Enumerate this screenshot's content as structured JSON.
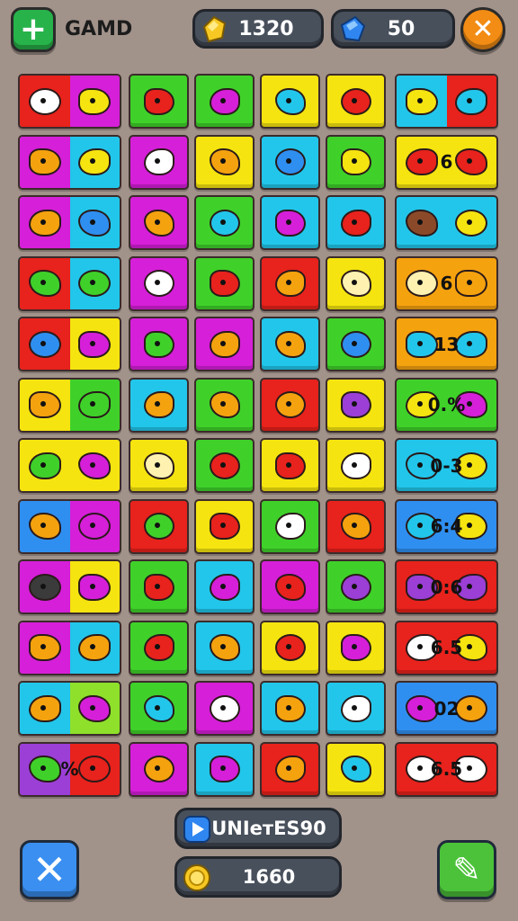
{
  "header": {
    "title": "GAMD",
    "coins": "1320",
    "gems": "50",
    "add_symbol": "+",
    "close_symbol": "✕"
  },
  "colors": {
    "red": "#e8221c",
    "magenta": "#d61fd8",
    "green": "#3fd12a",
    "yellow": "#f5e40f",
    "cyan": "#22c6ea",
    "blue": "#2f8ff0",
    "orange": "#f5a20f",
    "lime": "#8ee02a",
    "purple": "#9b3fd6"
  },
  "board": {
    "rows": [
      {
        "cells": [
          {
            "c": [
              "red",
              "magenta"
            ],
            "icons": [
              "#ffffff",
              "#f5e40f"
            ]
          },
          {
            "c": [
              "green"
            ],
            "icons": [
              "#e8221c"
            ]
          },
          {
            "c": [
              "green"
            ],
            "icons": [
              "#d61fd8"
            ]
          },
          {
            "c": [
              "yellow"
            ],
            "icons": [
              "#22c6ea"
            ]
          },
          {
            "c": [
              "yellow"
            ],
            "icons": [
              "#e8221c"
            ]
          },
          {
            "c": [
              "cyan",
              "red"
            ],
            "icons": [
              "#f5e40f",
              "#22c6ea"
            ]
          }
        ]
      },
      {
        "cells": [
          {
            "c": [
              "magenta",
              "cyan"
            ],
            "icons": [
              "#f5a20f",
              "#f5e40f"
            ]
          },
          {
            "c": [
              "magenta"
            ],
            "icons": [
              "#ffffff"
            ]
          },
          {
            "c": [
              "yellow"
            ],
            "icons": [
              "#f5a20f"
            ]
          },
          {
            "c": [
              "cyan"
            ],
            "icons": [
              "#2f8ff0"
            ]
          },
          {
            "c": [
              "green"
            ],
            "icons": [
              "#f5e40f"
            ]
          },
          {
            "c": [
              "yellow"
            ],
            "icons": [
              "#e8221c",
              "#e8221c"
            ],
            "label": "6"
          }
        ]
      },
      {
        "cells": [
          {
            "c": [
              "magenta",
              "cyan"
            ],
            "icons": [
              "#f5a20f",
              "#2f8ff0"
            ]
          },
          {
            "c": [
              "magenta"
            ],
            "icons": [
              "#f5a20f"
            ]
          },
          {
            "c": [
              "green"
            ],
            "icons": [
              "#22c6ea"
            ]
          },
          {
            "c": [
              "cyan"
            ],
            "icons": [
              "#d61fd8"
            ]
          },
          {
            "c": [
              "cyan"
            ],
            "icons": [
              "#e8221c"
            ]
          },
          {
            "c": [
              "cyan"
            ],
            "icons": [
              "#8a4a2a",
              "#f5e40f"
            ]
          }
        ]
      },
      {
        "cells": [
          {
            "c": [
              "red",
              "cyan"
            ],
            "icons": [
              "#3fd12a",
              "#3fd12a"
            ]
          },
          {
            "c": [
              "magenta"
            ],
            "icons": [
              "#ffffff"
            ]
          },
          {
            "c": [
              "green"
            ],
            "icons": [
              "#e8221c"
            ]
          },
          {
            "c": [
              "red"
            ],
            "icons": [
              "#f5a20f"
            ]
          },
          {
            "c": [
              "yellow"
            ],
            "icons": [
              "#fff2b0"
            ]
          },
          {
            "c": [
              "orange"
            ],
            "icons": [
              "#fff2b0",
              "#f5a20f"
            ],
            "label": "6"
          }
        ]
      },
      {
        "cells": [
          {
            "c": [
              "red",
              "yellow"
            ],
            "icons": [
              "#2f8ff0",
              "#d61fd8"
            ]
          },
          {
            "c": [
              "magenta"
            ],
            "icons": [
              "#3fd12a"
            ]
          },
          {
            "c": [
              "magenta"
            ],
            "icons": [
              "#f5a20f"
            ]
          },
          {
            "c": [
              "cyan"
            ],
            "icons": [
              "#f5a20f"
            ]
          },
          {
            "c": [
              "green"
            ],
            "icons": [
              "#2f8ff0"
            ]
          },
          {
            "c": [
              "orange"
            ],
            "icons": [
              "#22c6ea",
              "#22c6ea"
            ],
            "label": "13"
          }
        ]
      },
      {
        "cells": [
          {
            "c": [
              "yellow",
              "green"
            ],
            "icons": [
              "#f5a20f",
              "#3fd12a"
            ]
          },
          {
            "c": [
              "cyan"
            ],
            "icons": [
              "#f5a20f"
            ]
          },
          {
            "c": [
              "green"
            ],
            "icons": [
              "#f5a20f"
            ]
          },
          {
            "c": [
              "red"
            ],
            "icons": [
              "#f5a20f"
            ]
          },
          {
            "c": [
              "yellow"
            ],
            "icons": [
              "#9b3fd6"
            ]
          },
          {
            "c": [
              "green"
            ],
            "icons": [
              "#f5e40f",
              "#d61fd8"
            ],
            "label": "0.%"
          }
        ]
      },
      {
        "cells": [
          {
            "c": [
              "yellow",
              "yellow"
            ],
            "icons": [
              "#3fd12a",
              "#d61fd8"
            ]
          },
          {
            "c": [
              "yellow"
            ],
            "icons": [
              "#fff2b0"
            ]
          },
          {
            "c": [
              "green"
            ],
            "icons": [
              "#e8221c"
            ]
          },
          {
            "c": [
              "yellow"
            ],
            "icons": [
              "#e8221c"
            ]
          },
          {
            "c": [
              "yellow"
            ],
            "icons": [
              "#ffffff"
            ]
          },
          {
            "c": [
              "cyan"
            ],
            "icons": [
              "#22c6ea",
              "#f5e40f"
            ],
            "label": "0-3"
          }
        ]
      },
      {
        "cells": [
          {
            "c": [
              "blue",
              "magenta"
            ],
            "icons": [
              "#f5a20f",
              "#d61fd8"
            ]
          },
          {
            "c": [
              "red"
            ],
            "icons": [
              "#3fd12a"
            ]
          },
          {
            "c": [
              "yellow"
            ],
            "icons": [
              "#e8221c"
            ]
          },
          {
            "c": [
              "green"
            ],
            "icons": [
              "#ffffff"
            ]
          },
          {
            "c": [
              "red"
            ],
            "icons": [
              "#f5a20f"
            ]
          },
          {
            "c": [
              "blue"
            ],
            "icons": [
              "#22c6ea",
              "#f5e40f"
            ],
            "label": "6:4"
          }
        ]
      },
      {
        "cells": [
          {
            "c": [
              "magenta",
              "yellow"
            ],
            "icons": [
              "#3b3b3b",
              "#d61fd8"
            ]
          },
          {
            "c": [
              "green"
            ],
            "icons": [
              "#e8221c"
            ]
          },
          {
            "c": [
              "cyan"
            ],
            "icons": [
              "#d61fd8"
            ]
          },
          {
            "c": [
              "magenta"
            ],
            "icons": [
              "#e8221c"
            ]
          },
          {
            "c": [
              "green"
            ],
            "icons": [
              "#9b3fd6"
            ]
          },
          {
            "c": [
              "red"
            ],
            "icons": [
              "#9b3fd6",
              "#9b3fd6"
            ],
            "label": "0:6"
          }
        ]
      },
      {
        "cells": [
          {
            "c": [
              "magenta",
              "cyan"
            ],
            "icons": [
              "#f5a20f",
              "#f5a20f"
            ]
          },
          {
            "c": [
              "green"
            ],
            "icons": [
              "#e8221c"
            ]
          },
          {
            "c": [
              "cyan"
            ],
            "icons": [
              "#f5a20f"
            ]
          },
          {
            "c": [
              "yellow"
            ],
            "icons": [
              "#e8221c"
            ]
          },
          {
            "c": [
              "yellow"
            ],
            "icons": [
              "#d61fd8"
            ]
          },
          {
            "c": [
              "red"
            ],
            "icons": [
              "#ffffff",
              "#f5e40f"
            ],
            "label": "6.5"
          }
        ]
      },
      {
        "cells": [
          {
            "c": [
              "cyan",
              "lime"
            ],
            "icons": [
              "#f5a20f",
              "#d61fd8"
            ]
          },
          {
            "c": [
              "green"
            ],
            "icons": [
              "#22c6ea"
            ]
          },
          {
            "c": [
              "magenta"
            ],
            "icons": [
              "#ffffff"
            ]
          },
          {
            "c": [
              "cyan"
            ],
            "icons": [
              "#f5a20f"
            ]
          },
          {
            "c": [
              "cyan"
            ],
            "icons": [
              "#ffffff"
            ]
          },
          {
            "c": [
              "blue"
            ],
            "icons": [
              "#d61fd8",
              "#f5a20f"
            ],
            "label": "02"
          }
        ]
      },
      {
        "cells": [
          {
            "c": [
              "purple",
              "red"
            ],
            "icons": [
              "#3fd12a",
              "#e8221c"
            ],
            "label": "%"
          },
          {
            "c": [
              "magenta"
            ],
            "icons": [
              "#f5a20f"
            ]
          },
          {
            "c": [
              "cyan"
            ],
            "icons": [
              "#d61fd8"
            ]
          },
          {
            "c": [
              "red"
            ],
            "icons": [
              "#f5a20f"
            ]
          },
          {
            "c": [
              "yellow"
            ],
            "icons": [
              "#22c6ea"
            ]
          },
          {
            "c": [
              "red"
            ],
            "icons": [
              "#ffffff",
              "#ffffff"
            ],
            "label": "6.5"
          }
        ]
      }
    ]
  },
  "footer": {
    "level_label": "UNIeтES90",
    "score": "1660",
    "cancel_symbol": "✕",
    "confirm_symbol": "✎"
  }
}
